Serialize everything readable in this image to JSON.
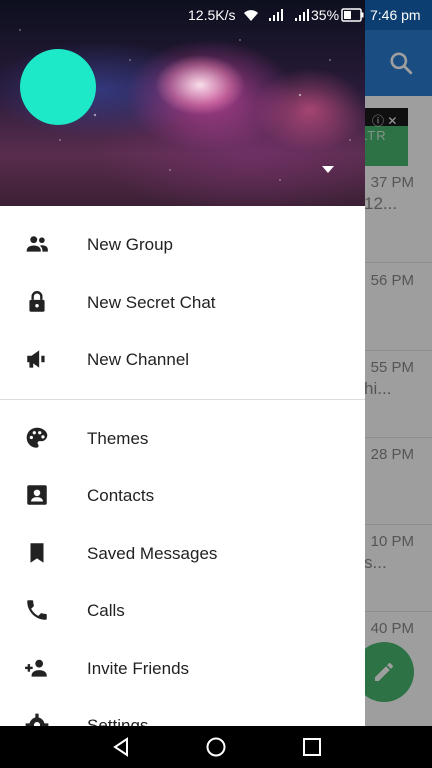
{
  "status_bar": {
    "net_speed": "12.5K/s",
    "battery": "35%",
    "time": "7:46 pm"
  },
  "background": {
    "ad_text": "LTR",
    "chats": [
      {
        "time": "37 PM",
        "preview": "12..."
      },
      {
        "time": "56 PM",
        "preview": ""
      },
      {
        "time": "55 PM",
        "preview": "hi..."
      },
      {
        "time": "28 PM",
        "preview": ""
      },
      {
        "time": "10 PM",
        "preview": "s..."
      },
      {
        "time": "40 PM",
        "preview": ""
      }
    ]
  },
  "drawer": {
    "menu": [
      {
        "label": "New Group",
        "icon": "group-icon"
      },
      {
        "label": "New Secret Chat",
        "icon": "lock-icon"
      },
      {
        "label": "New Channel",
        "icon": "megaphone-icon"
      },
      {
        "label": "Themes",
        "icon": "palette-icon"
      },
      {
        "label": "Contacts",
        "icon": "contact-card-icon"
      },
      {
        "label": "Saved Messages",
        "icon": "bookmark-icon"
      },
      {
        "label": "Calls",
        "icon": "phone-icon"
      },
      {
        "label": "Invite Friends",
        "icon": "add-person-icon"
      },
      {
        "label": "Settings",
        "icon": "gear-icon"
      }
    ]
  },
  "colors": {
    "toolbar": "#2b7fd4",
    "avatar": "#1de9c8",
    "fab": "#49b86f"
  }
}
